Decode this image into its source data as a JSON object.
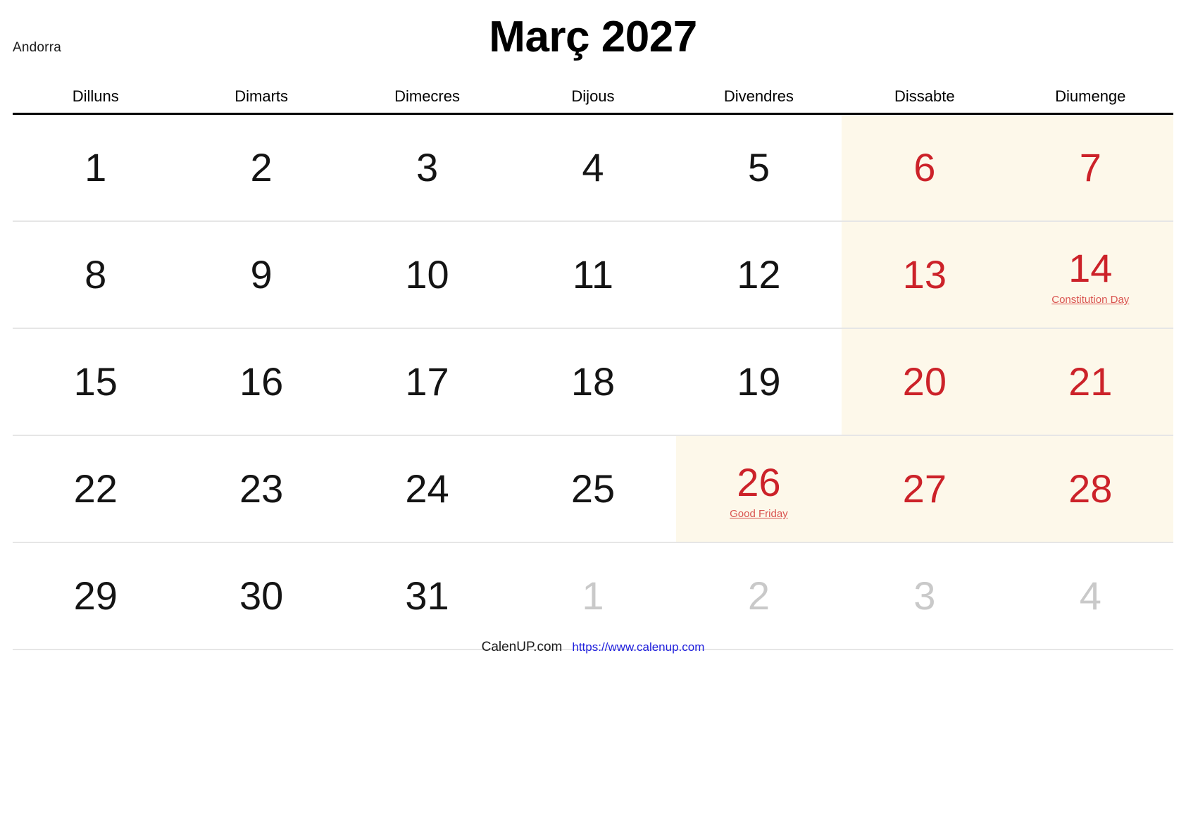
{
  "country": "Andorra",
  "title": "Març 2027",
  "weekdays": [
    "Dilluns",
    "Dimarts",
    "Dimecres",
    "Dijous",
    "Divendres",
    "Dissabte",
    "Diumenge"
  ],
  "colors": {
    "weekend_text": "#cc2229",
    "weekend_background": "#fdf8ea",
    "other_month_text": "#c9c9c9",
    "holiday_label": "#d9534f",
    "link": "#2020dd",
    "header_rule": "#000000",
    "row_rule": "#e6e6e6"
  },
  "weeks": [
    [
      {
        "day": "1",
        "type": "weekday",
        "shaded": false,
        "label": ""
      },
      {
        "day": "2",
        "type": "weekday",
        "shaded": false,
        "label": ""
      },
      {
        "day": "3",
        "type": "weekday",
        "shaded": false,
        "label": ""
      },
      {
        "day": "4",
        "type": "weekday",
        "shaded": false,
        "label": ""
      },
      {
        "day": "5",
        "type": "weekday",
        "shaded": false,
        "label": ""
      },
      {
        "day": "6",
        "type": "weekend",
        "shaded": true,
        "label": ""
      },
      {
        "day": "7",
        "type": "weekend",
        "shaded": true,
        "label": ""
      }
    ],
    [
      {
        "day": "8",
        "type": "weekday",
        "shaded": false,
        "label": ""
      },
      {
        "day": "9",
        "type": "weekday",
        "shaded": false,
        "label": ""
      },
      {
        "day": "10",
        "type": "weekday",
        "shaded": false,
        "label": ""
      },
      {
        "day": "11",
        "type": "weekday",
        "shaded": false,
        "label": ""
      },
      {
        "day": "12",
        "type": "weekday",
        "shaded": false,
        "label": ""
      },
      {
        "day": "13",
        "type": "weekend",
        "shaded": true,
        "label": ""
      },
      {
        "day": "14",
        "type": "holiday",
        "shaded": true,
        "label": "Constitution Day"
      }
    ],
    [
      {
        "day": "15",
        "type": "weekday",
        "shaded": false,
        "label": ""
      },
      {
        "day": "16",
        "type": "weekday",
        "shaded": false,
        "label": ""
      },
      {
        "day": "17",
        "type": "weekday",
        "shaded": false,
        "label": ""
      },
      {
        "day": "18",
        "type": "weekday",
        "shaded": false,
        "label": ""
      },
      {
        "day": "19",
        "type": "weekday",
        "shaded": false,
        "label": ""
      },
      {
        "day": "20",
        "type": "weekend",
        "shaded": true,
        "label": ""
      },
      {
        "day": "21",
        "type": "weekend",
        "shaded": true,
        "label": ""
      }
    ],
    [
      {
        "day": "22",
        "type": "weekday",
        "shaded": false,
        "label": ""
      },
      {
        "day": "23",
        "type": "weekday",
        "shaded": false,
        "label": ""
      },
      {
        "day": "24",
        "type": "weekday",
        "shaded": false,
        "label": ""
      },
      {
        "day": "25",
        "type": "weekday",
        "shaded": false,
        "label": ""
      },
      {
        "day": "26",
        "type": "holiday",
        "shaded": true,
        "label": "Good Friday"
      },
      {
        "day": "27",
        "type": "weekend",
        "shaded": true,
        "label": ""
      },
      {
        "day": "28",
        "type": "weekend",
        "shaded": true,
        "label": ""
      }
    ],
    [
      {
        "day": "29",
        "type": "weekday",
        "shaded": false,
        "label": ""
      },
      {
        "day": "30",
        "type": "weekday",
        "shaded": false,
        "label": ""
      },
      {
        "day": "31",
        "type": "weekday",
        "shaded": false,
        "label": ""
      },
      {
        "day": "1",
        "type": "other",
        "shaded": false,
        "label": ""
      },
      {
        "day": "2",
        "type": "other",
        "shaded": false,
        "label": ""
      },
      {
        "day": "3",
        "type": "other",
        "shaded": false,
        "label": ""
      },
      {
        "day": "4",
        "type": "other",
        "shaded": false,
        "label": ""
      }
    ]
  ],
  "footer": {
    "brand": "CalenUP.com",
    "url": "https://www.calenup.com"
  }
}
